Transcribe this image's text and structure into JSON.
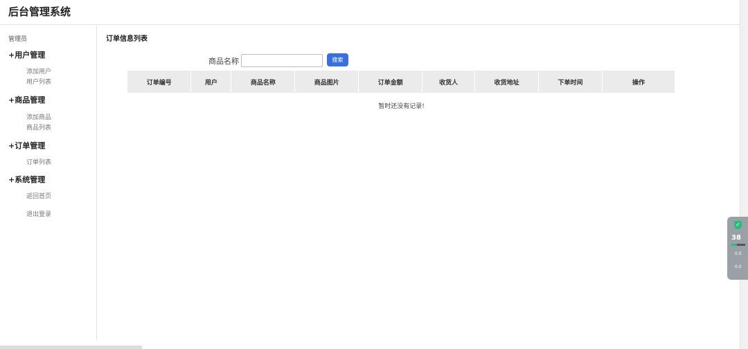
{
  "header": {
    "title": "后台管理系统"
  },
  "sidebar": {
    "role": "管理员",
    "groups": [
      {
        "label": "+用户管理",
        "items": [
          "添加用户",
          "用户列表"
        ]
      },
      {
        "label": "+商品管理",
        "items": [
          "添加商品",
          "商品列表"
        ]
      },
      {
        "label": "+订单管理",
        "items": [
          "订单列表"
        ]
      },
      {
        "label": "+系统管理",
        "items": [
          "返回首页",
          "退出登录"
        ]
      }
    ]
  },
  "main": {
    "title": "订单信息列表",
    "search": {
      "label": "商品名称",
      "value": "",
      "button": "搜索"
    },
    "table": {
      "columns": [
        "订单编号",
        "用户",
        "商品名称",
        "商品图片",
        "订单金额",
        "收货人",
        "收货地址",
        "下单时间",
        "操作"
      ],
      "rows": []
    },
    "empty_text": "暂时还没有记录!"
  },
  "widget": {
    "percent": "38",
    "percent_fill": 0.38,
    "up": "0.0",
    "down": "0.0",
    "accent": "#2dbb7a"
  }
}
